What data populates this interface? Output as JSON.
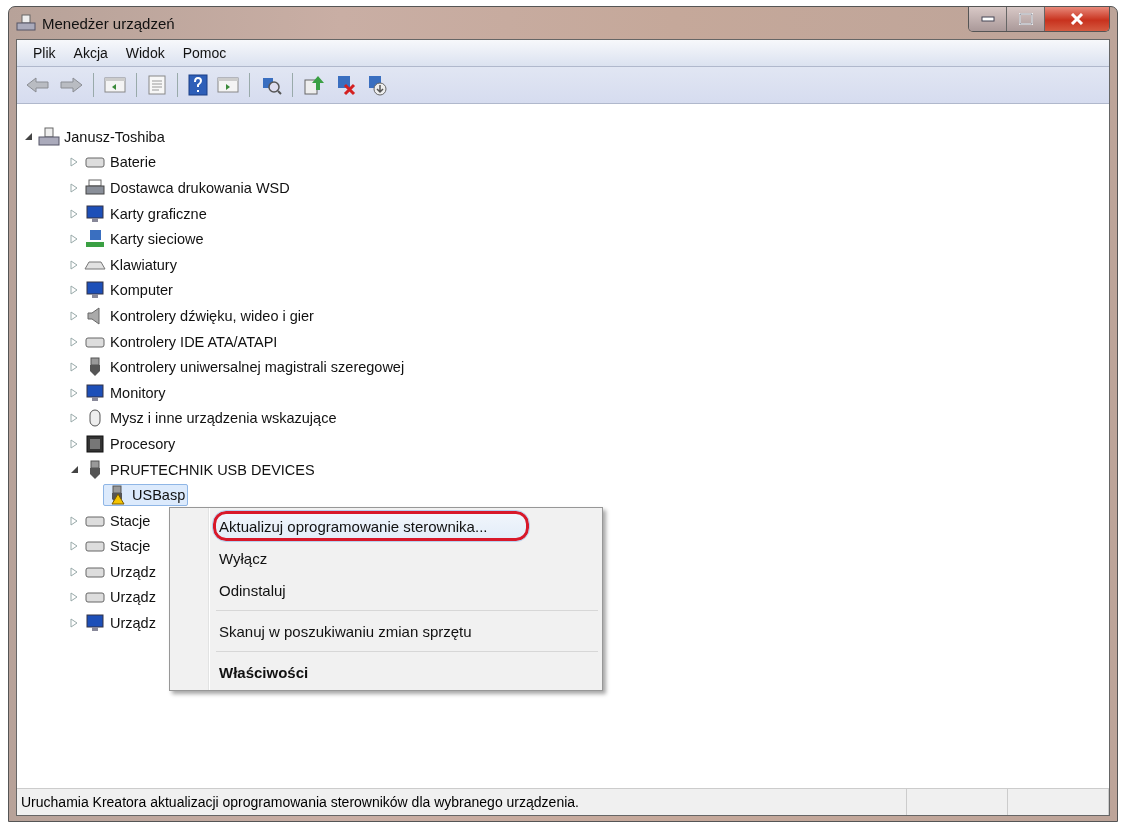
{
  "window": {
    "title": "Menedżer urządzeń"
  },
  "menu_bar": [
    "Plik",
    "Akcja",
    "Widok",
    "Pomoc"
  ],
  "tree": [
    {
      "label": "Janusz-Toshiba",
      "expanded": true,
      "selected": false,
      "children": [
        {
          "label": "Baterie",
          "expanded": false,
          "selected": false
        },
        {
          "label": "Dostawca drukowania WSD",
          "expanded": false,
          "selected": false
        },
        {
          "label": "Karty graficzne",
          "expanded": false,
          "selected": false
        },
        {
          "label": "Karty sieciowe",
          "expanded": false,
          "selected": false
        },
        {
          "label": "Klawiatury",
          "expanded": false,
          "selected": false
        },
        {
          "label": "Komputer",
          "expanded": false,
          "selected": false
        },
        {
          "label": "Kontrolery dźwięku, wideo i gier",
          "expanded": false,
          "selected": false
        },
        {
          "label": "Kontrolery IDE ATA/ATAPI",
          "expanded": false,
          "selected": false
        },
        {
          "label": "Kontrolery uniwersalnej magistrali szeregowej",
          "expanded": false,
          "selected": false
        },
        {
          "label": "Monitory",
          "expanded": false,
          "selected": false
        },
        {
          "label": "Mysz i inne urządzenia wskazujące",
          "expanded": false,
          "selected": false
        },
        {
          "label": "Procesory",
          "expanded": false,
          "selected": false
        },
        {
          "label": "PRUFTECHNIK USB DEVICES",
          "expanded": true,
          "selected": false,
          "children": [
            {
              "label": "USBasp",
              "selected": true,
              "warning": true
            }
          ]
        },
        {
          "label": "Stacje",
          "expanded": false,
          "selected": false
        },
        {
          "label": "Stacje",
          "expanded": false,
          "selected": false
        },
        {
          "label": "Urządz",
          "expanded": false,
          "selected": false
        },
        {
          "label": "Urządz",
          "expanded": false,
          "selected": false
        },
        {
          "label": "Urządz",
          "expanded": false,
          "selected": false
        }
      ]
    }
  ],
  "context_menu": [
    {
      "kind": "item",
      "label": "Aktualizuj oprogramowanie sterownika...",
      "selected": true,
      "circled": true
    },
    {
      "kind": "item",
      "label": "Wyłącz",
      "selected": false,
      "circled": false
    },
    {
      "kind": "item",
      "label": "Odinstaluj",
      "selected": false,
      "circled": false
    },
    {
      "kind": "separator"
    },
    {
      "kind": "item",
      "label": "Skanuj w poszukiwaniu zmian sprzętu",
      "selected": false,
      "circled": false
    },
    {
      "kind": "separator"
    },
    {
      "kind": "default",
      "label": "Właściwości",
      "selected": false,
      "circled": false
    }
  ],
  "status_bar": {
    "text": "Uruchamia Kreatora aktualizacji oprogramowania sterowników dla wybranego urządzenia."
  }
}
